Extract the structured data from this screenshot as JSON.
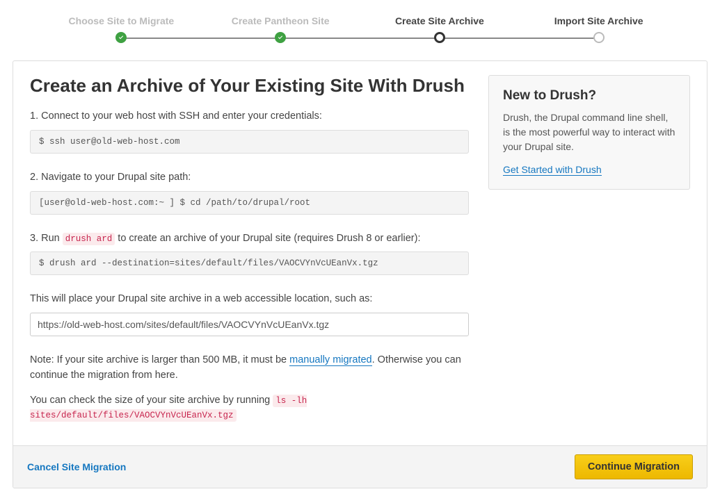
{
  "stepper": {
    "steps": [
      {
        "label": "Choose Site to Migrate"
      },
      {
        "label": "Create Pantheon Site"
      },
      {
        "label": "Create Site Archive"
      },
      {
        "label": "Import Site Archive"
      }
    ]
  },
  "page": {
    "title": "Create an Archive of Your Existing Site With Drush",
    "step1_text": "1. Connect to your web host with SSH and enter your credentials:",
    "step1_code": "$ ssh user@old-web-host.com",
    "step2_text": "2. Navigate to your Drupal site path:",
    "step2_code": "[user@old-web-host.com:~ ] $ cd /path/to/drupal/root",
    "step3_prefix": "3. Run ",
    "step3_inline_code": "drush ard",
    "step3_suffix": " to create an archive of your Drupal site (requires Drush 8 or earlier):",
    "step3_code": "$ drush ard --destination=sites/default/files/VAOCVYnVcUEanVx.tgz",
    "place_text": "This will place your Drupal site archive in a web accessible location, such as:",
    "place_value": "https://old-web-host.com/sites/default/files/VAOCVYnVcUEanVx.tgz",
    "note_prefix": "Note: If your site archive is larger than 500 MB, it must be ",
    "note_link": "manually migrated",
    "note_suffix": ". Otherwise you can continue the migration from here.",
    "size_prefix": "You can check the size of your site archive by running ",
    "size_code": "ls -lh sites/default/files/VAOCVYnVcUEanVx.tgz"
  },
  "aside": {
    "title": "New to Drush?",
    "body": "Drush, the Drupal command line shell, is the most powerful way to interact with your Drupal site.",
    "link": "Get Started with Drush"
  },
  "footer": {
    "cancel": "Cancel Site Migration",
    "continue": "Continue Migration"
  }
}
